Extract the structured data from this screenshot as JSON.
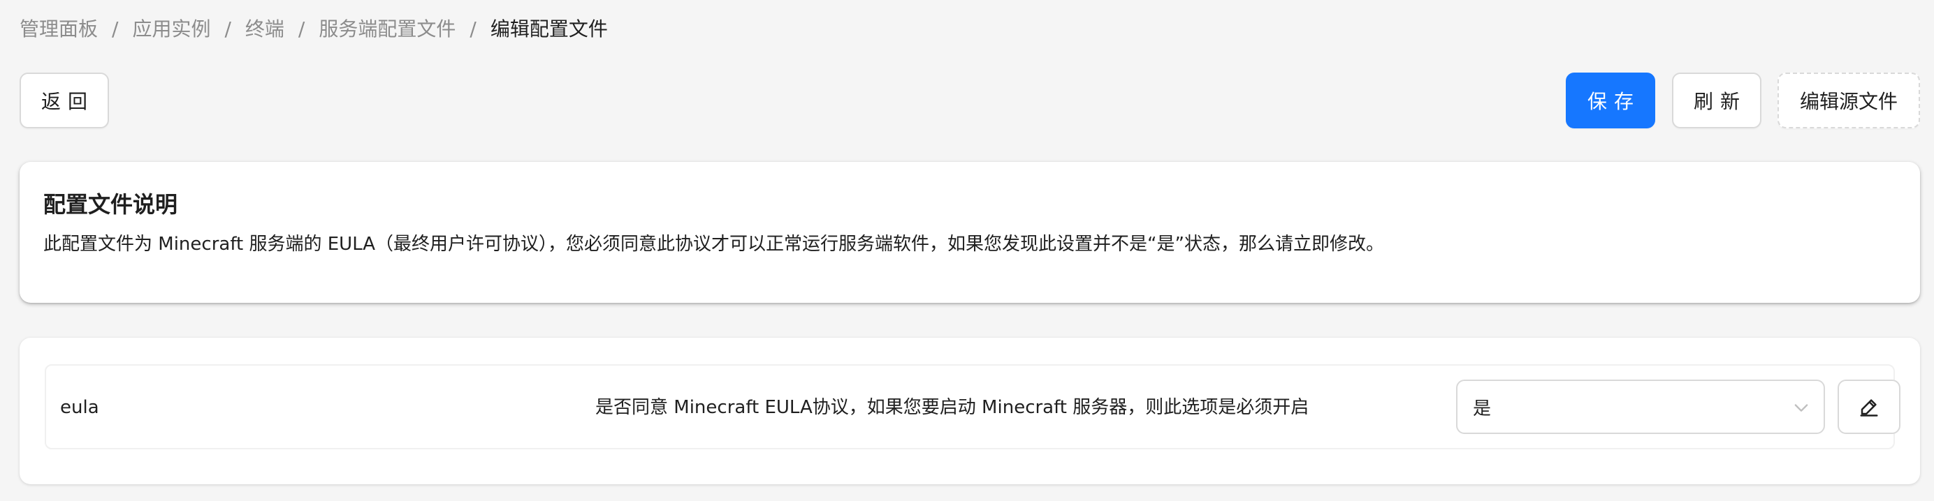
{
  "breadcrumb": {
    "items": [
      "管理面板",
      "应用实例",
      "终端",
      "服务端配置文件",
      "编辑配置文件"
    ],
    "separator": "/"
  },
  "toolbar": {
    "back_label": "返回",
    "save_label": "保存",
    "refresh_label": "刷新",
    "edit_source_label": "编辑源文件"
  },
  "description_card": {
    "title": "配置文件说明",
    "text": "此配置文件为 Minecraft 服务端的 EULA（最终用户许可协议），您必须同意此协议才可以正常运行服务端软件，如果您发现此设置并不是“是”状态，那么请立即修改。"
  },
  "config_rows": [
    {
      "key": "eula",
      "description": "是否同意 Minecraft EULA协议，如果您要启动 Minecraft 服务器，则此选项是必须开启",
      "value": "是"
    }
  ],
  "colors": {
    "primary": "#1677ff",
    "background": "#f5f5f5",
    "border": "#d9d9d9"
  },
  "icons": {
    "select_arrow": "chevron-down-icon",
    "edit": "edit-icon"
  }
}
